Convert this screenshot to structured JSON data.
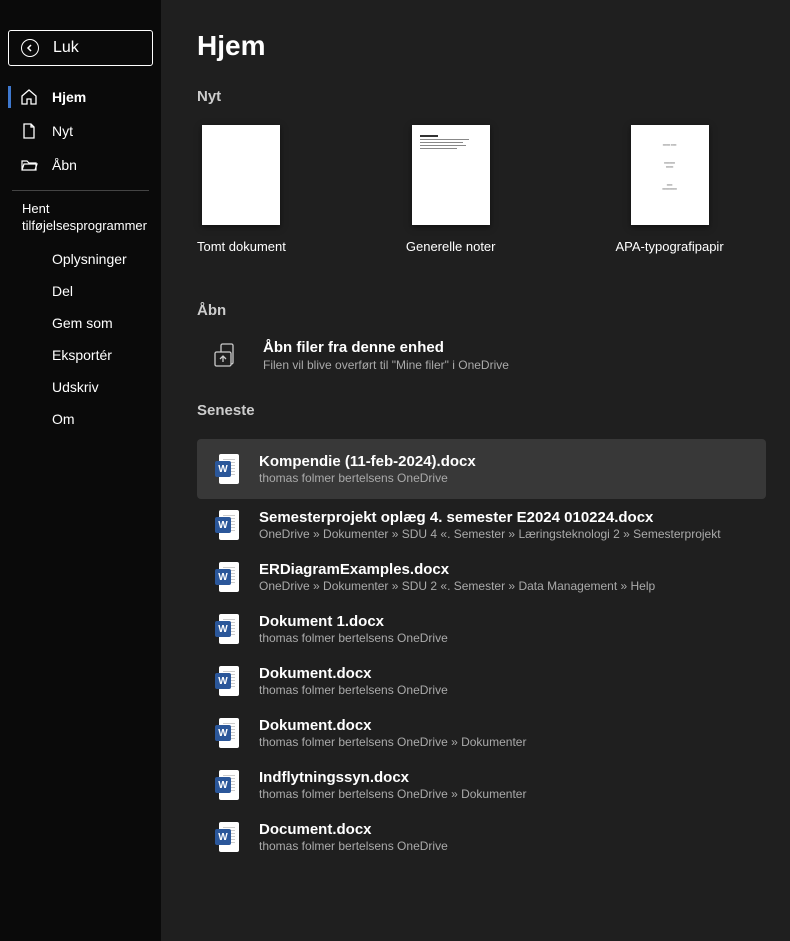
{
  "sidebar": {
    "close": "Luk",
    "home": "Hjem",
    "new": "Nyt",
    "open": "Åbn",
    "addins": "Hent tilføjelsesprogrammer",
    "info": "Oplysninger",
    "share": "Del",
    "saveas": "Gem som",
    "export": "Eksportér",
    "print": "Udskriv",
    "about": "Om"
  },
  "main": {
    "title": "Hjem",
    "new_section": "Nyt",
    "templates": [
      {
        "label": "Tomt dokument"
      },
      {
        "label": "Generelle noter"
      },
      {
        "label": "APA-typografipapir"
      }
    ],
    "open_section": "Åbn",
    "open_device_title": "Åbn filer fra denne enhed",
    "open_device_sub": "Filen vil blive overført til \"Mine filer\" i OneDrive",
    "recent_section": "Seneste",
    "recent": [
      {
        "name": "Kompendie (11-feb-2024).docx",
        "path": "thomas folmer bertelsens OneDrive"
      },
      {
        "name": "Semesterprojekt oplæg 4. semester E2024 010224.docx",
        "path": "OneDrive » Dokumenter » SDU 4 «. Semester » Læringsteknologi 2 » Semesterprojekt"
      },
      {
        "name": "ERDiagramExamples.docx",
        "path": "OneDrive » Dokumenter » SDU 2 «. Semester » Data Management » Help"
      },
      {
        "name": "Dokument 1.docx",
        "path": "thomas folmer bertelsens OneDrive"
      },
      {
        "name": "Dokument.docx",
        "path": "thomas folmer bertelsens OneDrive"
      },
      {
        "name": "Dokument.docx",
        "path": "thomas folmer bertelsens OneDrive » Dokumenter"
      },
      {
        "name": "Indflytningssyn.docx",
        "path": "thomas folmer bertelsens OneDrive » Dokumenter"
      },
      {
        "name": "Document.docx",
        "path": "thomas folmer bertelsens OneDrive"
      }
    ]
  }
}
